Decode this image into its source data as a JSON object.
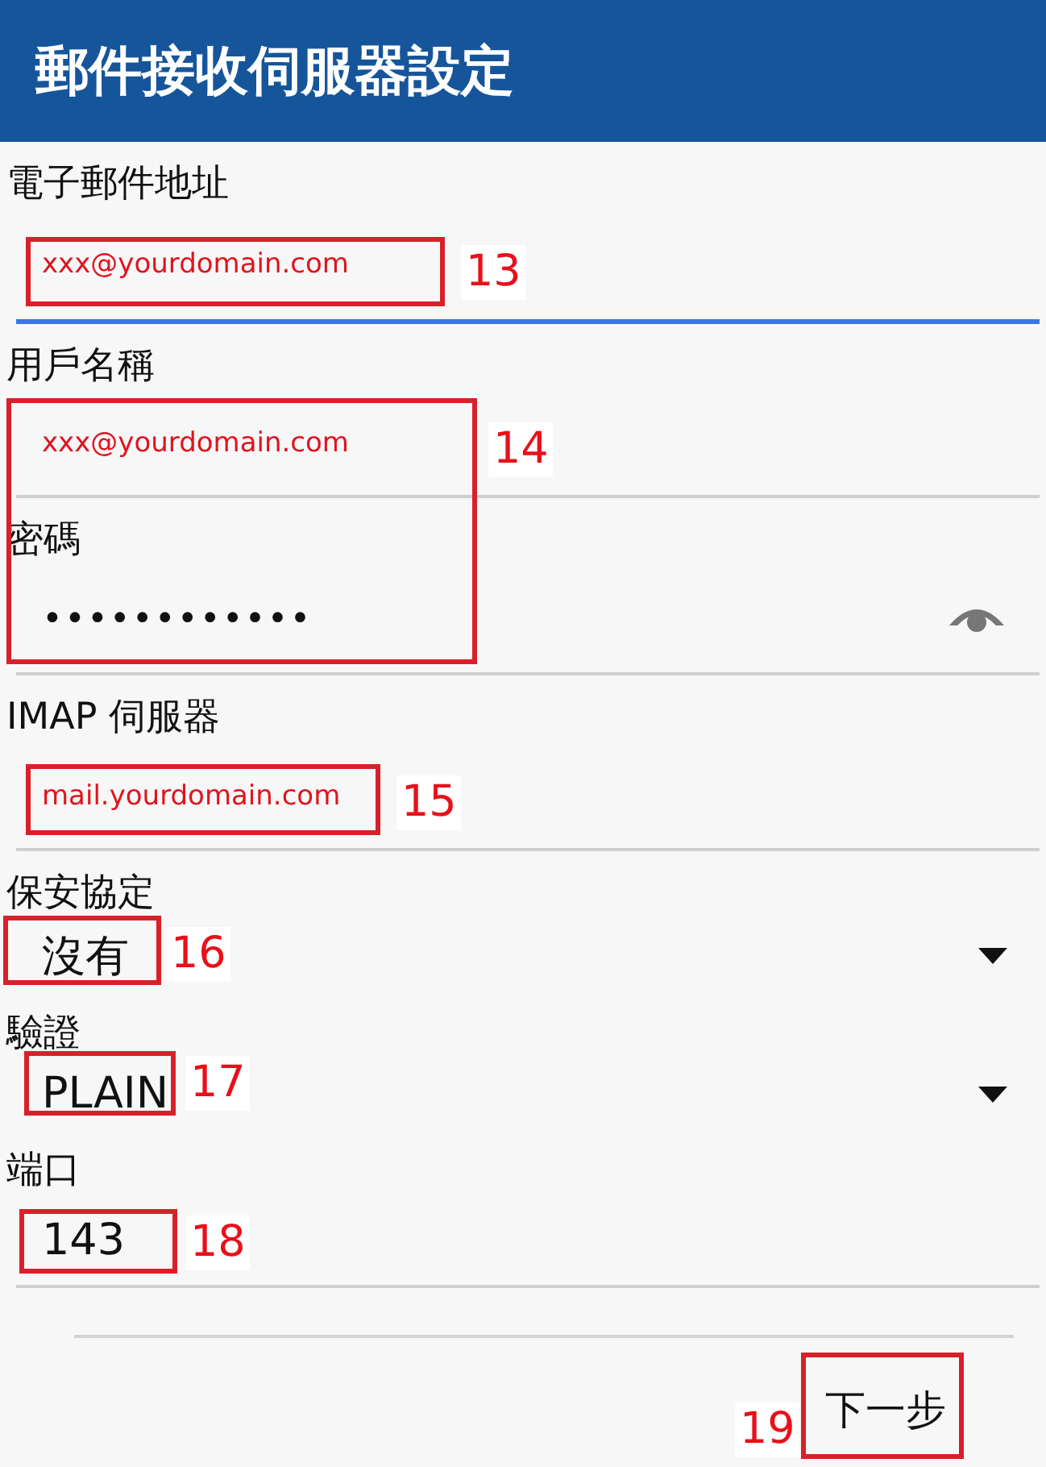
{
  "header": {
    "title": "郵件接收伺服器設定"
  },
  "fields": [
    {
      "kind": "text",
      "label": "電子郵件地址",
      "value": "xxx@yourdomain.com",
      "focused": true
    },
    {
      "kind": "text",
      "label": "用戶名稱",
      "value": "xxx@yourdomain.com",
      "focused": false
    },
    {
      "kind": "password",
      "label": "密碼",
      "value": "••••••••••••",
      "focused": false
    },
    {
      "kind": "text",
      "label": "IMAP 伺服器",
      "value": "mail.yourdomain.com",
      "focused": false
    },
    {
      "kind": "dropdown",
      "label": "保安協定",
      "value": "沒有"
    },
    {
      "kind": "dropdown",
      "label": "驗證",
      "value": "PLAIN"
    },
    {
      "kind": "number",
      "label": "端口",
      "value": "143",
      "focused": false
    }
  ],
  "next_button": {
    "label": "下一步"
  },
  "callouts": [
    {
      "number": "13"
    },
    {
      "number": "14"
    },
    {
      "number": "15"
    },
    {
      "number": "16"
    },
    {
      "number": "17"
    },
    {
      "number": "18"
    },
    {
      "number": "19"
    }
  ]
}
